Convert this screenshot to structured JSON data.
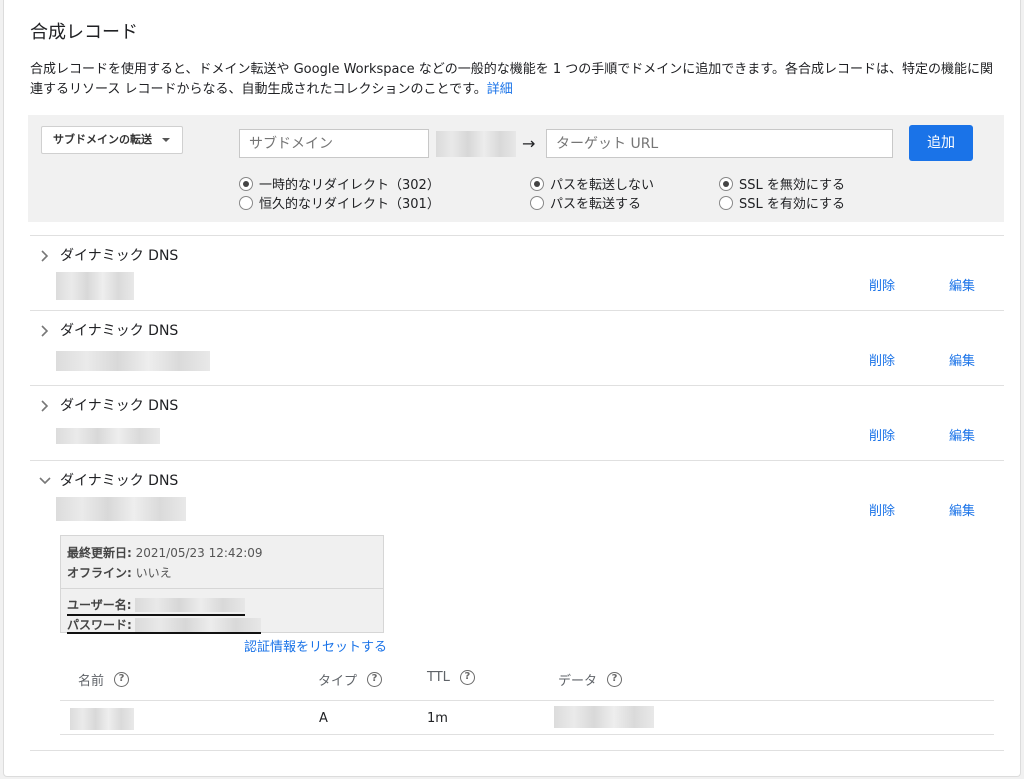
{
  "page": {
    "title": "合成レコード",
    "description": "合成レコードを使用すると、ドメイン転送や Google Workspace などの一般的な機能を 1 つの手順でドメインに追加できます。各合成レコードは、特定の機能に関連するリソース レコードからなる、自動生成されたコレクションのことです。",
    "details_link": "詳細"
  },
  "form": {
    "type_select": "サブドメインの転送",
    "subdomain_placeholder": "サブドメイン",
    "arrow": "→",
    "target_placeholder": "ターゲット URL",
    "add_button": "追加",
    "redirect_options": [
      {
        "label": "一時的なリダイレクト（302）",
        "selected": true
      },
      {
        "label": "恒久的なリダイレクト（301）",
        "selected": false
      }
    ],
    "path_options": [
      {
        "label": "パスを転送しない",
        "selected": true
      },
      {
        "label": "パスを転送する",
        "selected": false
      }
    ],
    "ssl_options": [
      {
        "label": "SSL を無効にする",
        "selected": true
      },
      {
        "label": "SSL を有効にする",
        "selected": false
      }
    ]
  },
  "records": [
    {
      "title": "ダイナミック DNS",
      "expanded": false,
      "delete": "削除",
      "edit": "編集"
    },
    {
      "title": "ダイナミック DNS",
      "expanded": false,
      "delete": "削除",
      "edit": "編集"
    },
    {
      "title": "ダイナミック DNS",
      "expanded": false,
      "delete": "削除",
      "edit": "編集"
    },
    {
      "title": "ダイナミック DNS",
      "expanded": true,
      "delete": "削除",
      "edit": "編集"
    }
  ],
  "details": {
    "last_updated_label": "最終更新日:",
    "last_updated_value": "2021/05/23 12:42:09",
    "offline_label": "オフライン:",
    "offline_value": "いいえ",
    "username_label": "ユーザー名:",
    "password_label": "パスワード:",
    "reset_link": "認証情報をリセットする"
  },
  "table": {
    "headers": [
      "名前",
      "タイプ",
      "TTL",
      "データ"
    ],
    "help_icon": "?",
    "rows": [
      {
        "type": "A",
        "ttl": "1m"
      }
    ]
  },
  "colors": {
    "accent": "#1a73e8",
    "panel_bg": "#f1f1f1"
  }
}
